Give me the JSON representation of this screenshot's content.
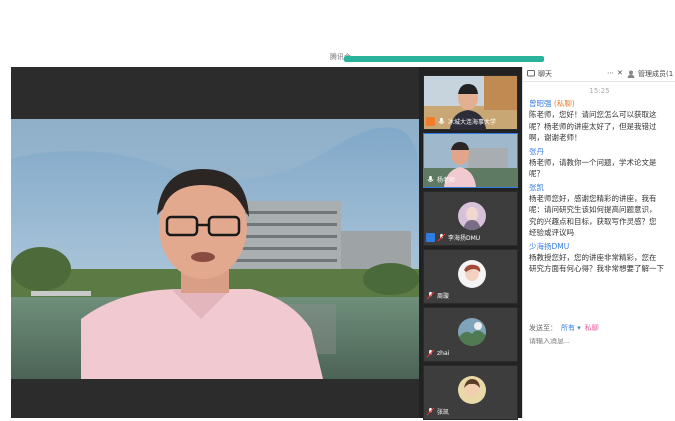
{
  "topbar": {
    "label": "腾讯会",
    "progress": 1.0
  },
  "main_speaker": {
    "name": "杨老师"
  },
  "thumbnails": [
    {
      "name": "冰城大连海事大学",
      "active": false,
      "type": "video",
      "tag_color": "#f07c2c"
    },
    {
      "name": "杨老师",
      "active": true,
      "type": "video",
      "tag_color": ""
    },
    {
      "name": "李海扬DMU",
      "active": false,
      "type": "avatar",
      "tag_color": "#2f7de1"
    },
    {
      "name": "周璇",
      "active": false,
      "type": "avatar",
      "tag_color": ""
    },
    {
      "name": "zhai",
      "active": false,
      "type": "avatar",
      "tag_color": ""
    },
    {
      "name": "张凯",
      "active": false,
      "type": "avatar",
      "tag_color": ""
    }
  ],
  "chat": {
    "tab_chat": "聊天",
    "tab_members": "管理成员(1",
    "time": "15:25",
    "messages": [
      {
        "sender": "曾昭强",
        "tag": "(私聊)",
        "lines": [
          "陈老师，您好！请问您怎么可以获取这",
          "呢？杨老师的讲座太好了，但是我错过",
          "啊，谢谢老师！"
        ]
      },
      {
        "sender": "张丹",
        "tag": "",
        "lines": [
          "杨老师，请教你一个问题，学术论文是",
          "呢？"
        ]
      },
      {
        "sender": "张凯",
        "tag": "",
        "lines": [
          "杨老师您好，感谢您精彩的讲座，我有",
          "呢：请问研究生该如何提高问题意识，",
          "究的兴趣点和目标，获取写作灵感？您",
          "经验或评议吗"
        ]
      },
      {
        "sender": "少海扬DMU",
        "tag": "",
        "lines": [
          "杨教授您好，您的讲座非常精彩，您在",
          "研究方面有何心得？我非常想要了解一下"
        ]
      }
    ],
    "send_label": "发送至：",
    "send_target": "所有",
    "send_private": "私聊",
    "input_placeholder": "请输入消息..."
  }
}
